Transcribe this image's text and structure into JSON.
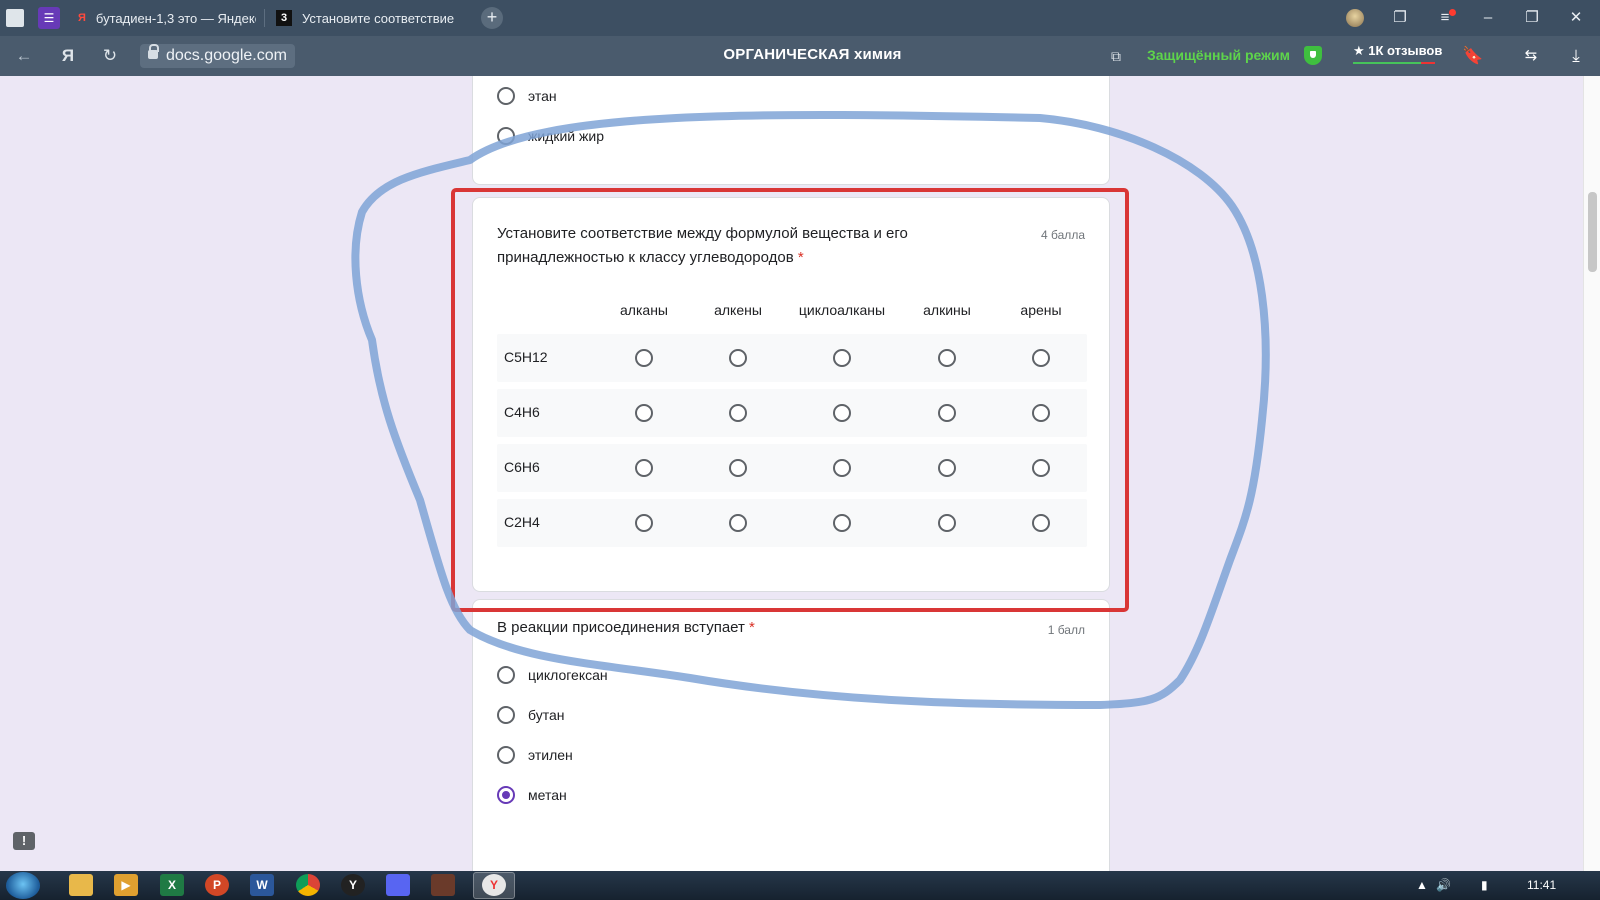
{
  "browser": {
    "tabs": [
      {
        "label": "бутадиен-1,3 это — Яндекс",
        "favicon": "yandex-icon"
      },
      {
        "label": "Установите соответствие",
        "favicon": "3"
      }
    ],
    "new_tab_label": "+",
    "url": "docs.google.com",
    "page_title": "ОРГАНИЧЕСКАЯ химия",
    "protected_mode": "Защищённый режим",
    "reviews": "★ 1К отзывов"
  },
  "form": {
    "prev_question": {
      "options": [
        "этан",
        "жидкий жир"
      ]
    },
    "grid_question": {
      "title": "Установите соответствие между формулой вещества и его принадлежностью к классу углеводородов",
      "required_mark": "*",
      "points": "4 балла",
      "columns": [
        "алканы",
        "алкены",
        "циклоалканы",
        "алкины",
        "арены"
      ],
      "rows": [
        "C5H12",
        "C4H6",
        "C6H6",
        "C2H4"
      ]
    },
    "next_question": {
      "title": "В реакции присоединения вступает",
      "required_mark": "*",
      "points": "1 балл",
      "options": [
        "циклогексан",
        "бутан",
        "этилен",
        "метан"
      ],
      "selected": "метан"
    }
  },
  "feedback_label": "!",
  "taskbar": {
    "clock": "11:41"
  },
  "colors": {
    "accent": "#673ab7",
    "annotation_red": "#d93636",
    "annotation_blue": "#7fa3d6",
    "protected_green": "#5ed44b"
  }
}
